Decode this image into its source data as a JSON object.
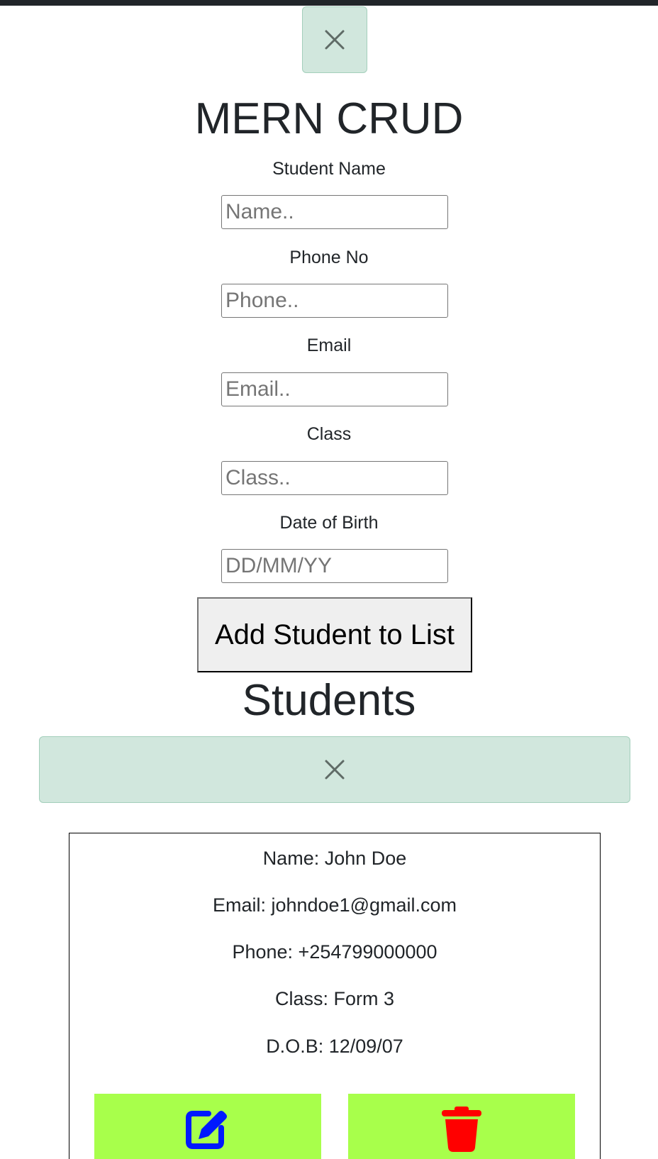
{
  "app": {
    "title": "MERN CRUD"
  },
  "form": {
    "name": {
      "label": "Student Name",
      "placeholder": "Name.."
    },
    "phone": {
      "label": "Phone No",
      "placeholder": "Phone.."
    },
    "email": {
      "label": "Email",
      "placeholder": "Email.."
    },
    "class": {
      "label": "Class",
      "placeholder": "Class.."
    },
    "dob": {
      "label": "Date of Birth",
      "placeholder": "DD/MM/YY"
    },
    "submit_label": "Add Student to List"
  },
  "students": {
    "heading": "Students",
    "items": [
      {
        "name": "Name: John Doe",
        "email": "Email: johndoe1@gmail.com",
        "phone": "Phone: +254799000000",
        "class": "Class: Form 3",
        "dob": "D.O.B: 12/09/07"
      }
    ]
  },
  "icons": {
    "close": "close-icon",
    "edit": "edit-icon",
    "delete": "trash-icon"
  },
  "colors": {
    "alert_bg": "#d1e7dd",
    "action_bg": "#a8ff4b",
    "edit_icon": "#0019ff",
    "delete_icon": "#ff0000"
  }
}
